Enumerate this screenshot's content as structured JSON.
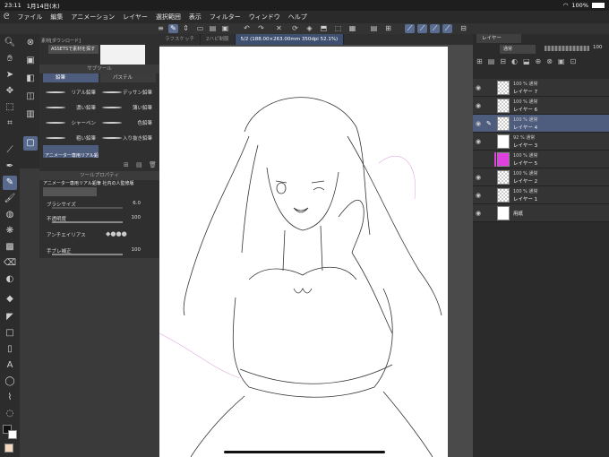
{
  "status": {
    "time": "23:11",
    "date": "1月14日(木)",
    "battery": "100%"
  },
  "menu": [
    "ファイル",
    "編集",
    "アニメーション",
    "レイヤー",
    "選択範囲",
    "表示",
    "フィルター",
    "ウィンドウ",
    "ヘルプ"
  ],
  "left_top": {
    "asset_title": "素材[ダウンロード]",
    "asset_button": "ASSETSで素材を探す"
  },
  "subtool": {
    "header": "サブツール",
    "tab_active": "鉛筆",
    "tab_other": "パステル",
    "brushes": [
      [
        "リアル鉛筆",
        "デッサン鉛筆"
      ],
      [
        "濃い鉛筆",
        "薄い鉛筆"
      ],
      [
        "シャーペン",
        "色鉛筆"
      ],
      [
        "粗い鉛筆",
        "入り抜き鉛筆"
      ],
      [
        "アニメーター専用リアル鉛筆",
        ""
      ]
    ]
  },
  "toolprop": {
    "header": "ツールプロパティ",
    "title": "アニメーター専用リアル鉛筆 社内の人監修版",
    "size_label": "ブラシサイズ",
    "size_value": "6.0",
    "opacity_label": "不透明度",
    "opacity_value": "100",
    "aa_label": "アンチエイリアス",
    "stab_label": "手ブレ補正",
    "stab_value": "100"
  },
  "tabs": [
    "ラフスケッチ",
    "2ハピ制服",
    "5/2 (188.00×263.00mm 350dpi 52.1%)"
  ],
  "layers_panel": {
    "title": "レイヤー",
    "blend": "通常",
    "opacity": "100"
  },
  "layers": [
    {
      "pct": "100 % 通常",
      "name": "レイヤー 7",
      "thumb": "check"
    },
    {
      "pct": "100 % 通常",
      "name": "レイヤー 6",
      "thumb": "check"
    },
    {
      "pct": "100 % 通常",
      "name": "レイヤー 4",
      "thumb": "check"
    },
    {
      "pct": "92 % 通常",
      "name": "レイヤー 3",
      "thumb": "white"
    },
    {
      "pct": "100 % 通常",
      "name": "レイヤー 5",
      "thumb": "white"
    },
    {
      "pct": "100 % 通常",
      "name": "レイヤー 2",
      "thumb": "check"
    },
    {
      "pct": "100 % 通常",
      "name": "レイヤー 1",
      "thumb": "check"
    },
    {
      "pct": "",
      "name": "用紙",
      "thumb": "white"
    }
  ],
  "colors": {
    "accent": "#57698c",
    "layer5": "#e040e0"
  }
}
